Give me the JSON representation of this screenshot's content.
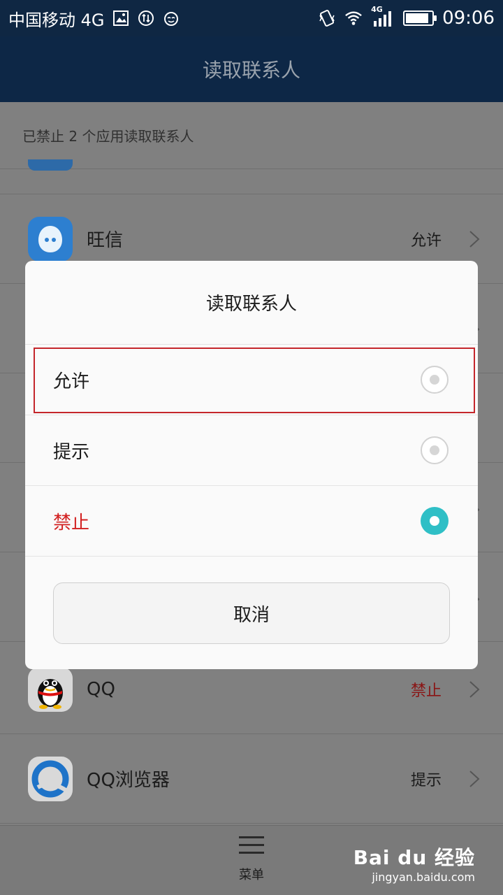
{
  "status_bar": {
    "carrier": "中国移动 4G",
    "network_label": "4G",
    "time": "09:06",
    "battery_level": 0.9
  },
  "header": {
    "title": "读取联系人"
  },
  "page": {
    "subtitle": "已禁止 2 个应用读取联系人",
    "apps": [
      {
        "name": "旺信",
        "status": "允许"
      },
      {
        "name": "QQ",
        "status": "禁止"
      },
      {
        "name": "QQ浏览器",
        "status": "提示"
      }
    ]
  },
  "dialog": {
    "title": "读取联系人",
    "options": [
      {
        "label": "允许",
        "selected": false
      },
      {
        "label": "提示",
        "selected": false
      },
      {
        "label": "禁止",
        "selected": true
      }
    ],
    "cancel_label": "取消"
  },
  "menu": {
    "label": "菜单"
  },
  "watermark": {
    "logo": "Bai du 经验",
    "url": "jingyan.baidu.com"
  },
  "colors": {
    "accent": "#2fbfc6",
    "danger": "#d22020",
    "header_bg": "#0d2746",
    "highlight_box": "#c4262b"
  }
}
